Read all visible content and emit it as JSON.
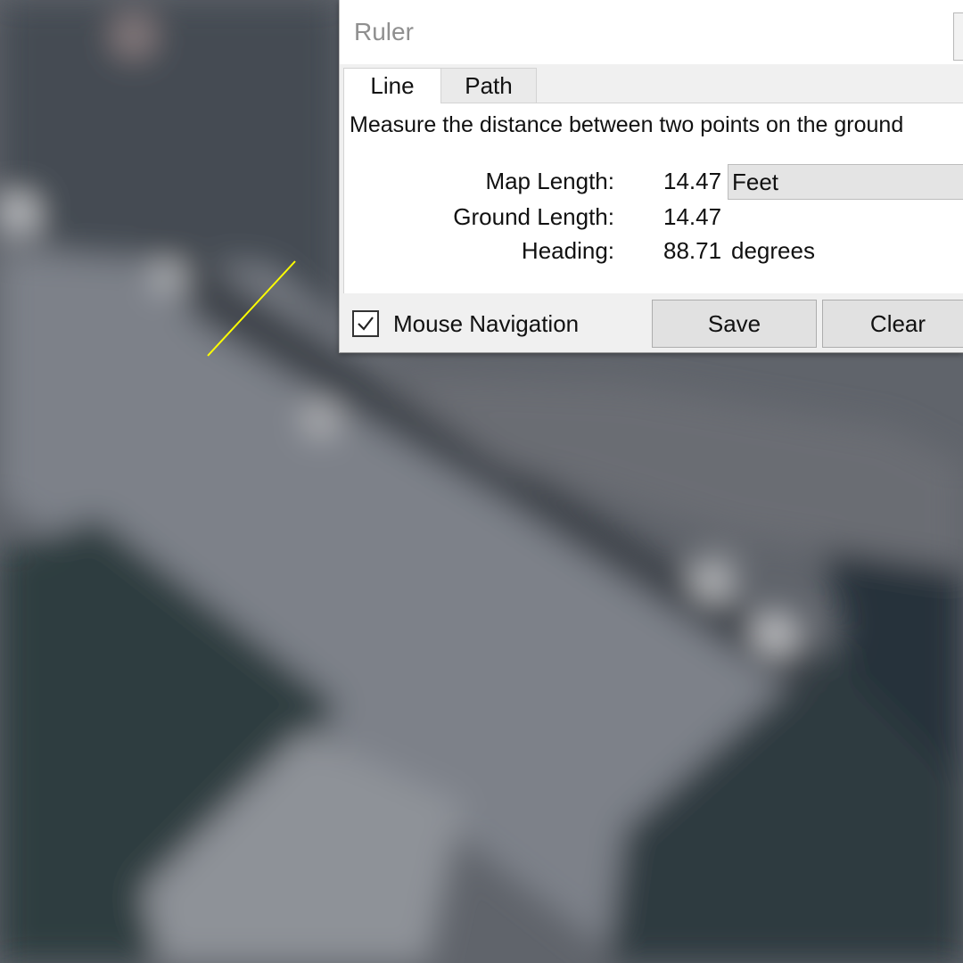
{
  "dialog": {
    "title": "Ruler",
    "tabs": [
      {
        "label": "Line",
        "active": true
      },
      {
        "label": "Path",
        "active": false
      }
    ],
    "description": "Measure the distance between two points on the ground",
    "map_length": {
      "label": "Map Length:",
      "value": "14.47",
      "unit": "Feet"
    },
    "ground_length": {
      "label": "Ground Length:",
      "value": "14.47"
    },
    "heading": {
      "label": "Heading:",
      "value": "88.71",
      "unit": "degrees"
    },
    "mouse_navigation": {
      "label": "Mouse Navigation",
      "checked": true
    },
    "save_label": "Save",
    "clear_label": "Clear"
  },
  "map": {
    "measure_line_color": "#ffff00"
  }
}
